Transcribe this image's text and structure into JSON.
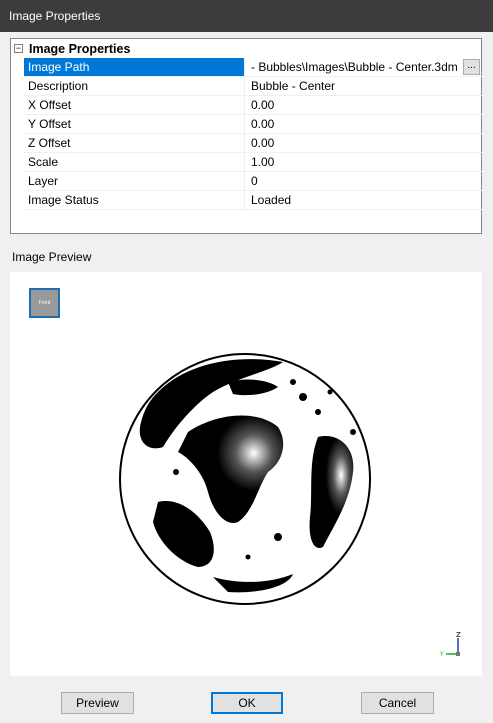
{
  "window": {
    "title": "Image Properties"
  },
  "properties": {
    "category": "Image Properties",
    "expander": "−",
    "rows": [
      {
        "name": "Image Path",
        "value": "- Bubbles\\Images\\Bubble - Center.3dm"
      },
      {
        "name": "Description",
        "value": "Bubble - Center"
      },
      {
        "name": "X Offset",
        "value": "0.00"
      },
      {
        "name": "Y Offset",
        "value": "0.00"
      },
      {
        "name": "Z Offset",
        "value": "0.00"
      },
      {
        "name": "Scale",
        "value": "1.00"
      },
      {
        "name": "Layer",
        "value": "0"
      },
      {
        "name": "Image Status",
        "value": "Loaded"
      }
    ],
    "browse_label": "..."
  },
  "preview": {
    "label": "Image Preview",
    "view_button": "Front",
    "axis_z": "Z",
    "axis_y": "Y"
  },
  "buttons": {
    "preview": "Preview",
    "ok": "OK",
    "cancel": "Cancel"
  },
  "colors": {
    "selection": "#0078d7",
    "titlebar": "#3c3c3c"
  }
}
